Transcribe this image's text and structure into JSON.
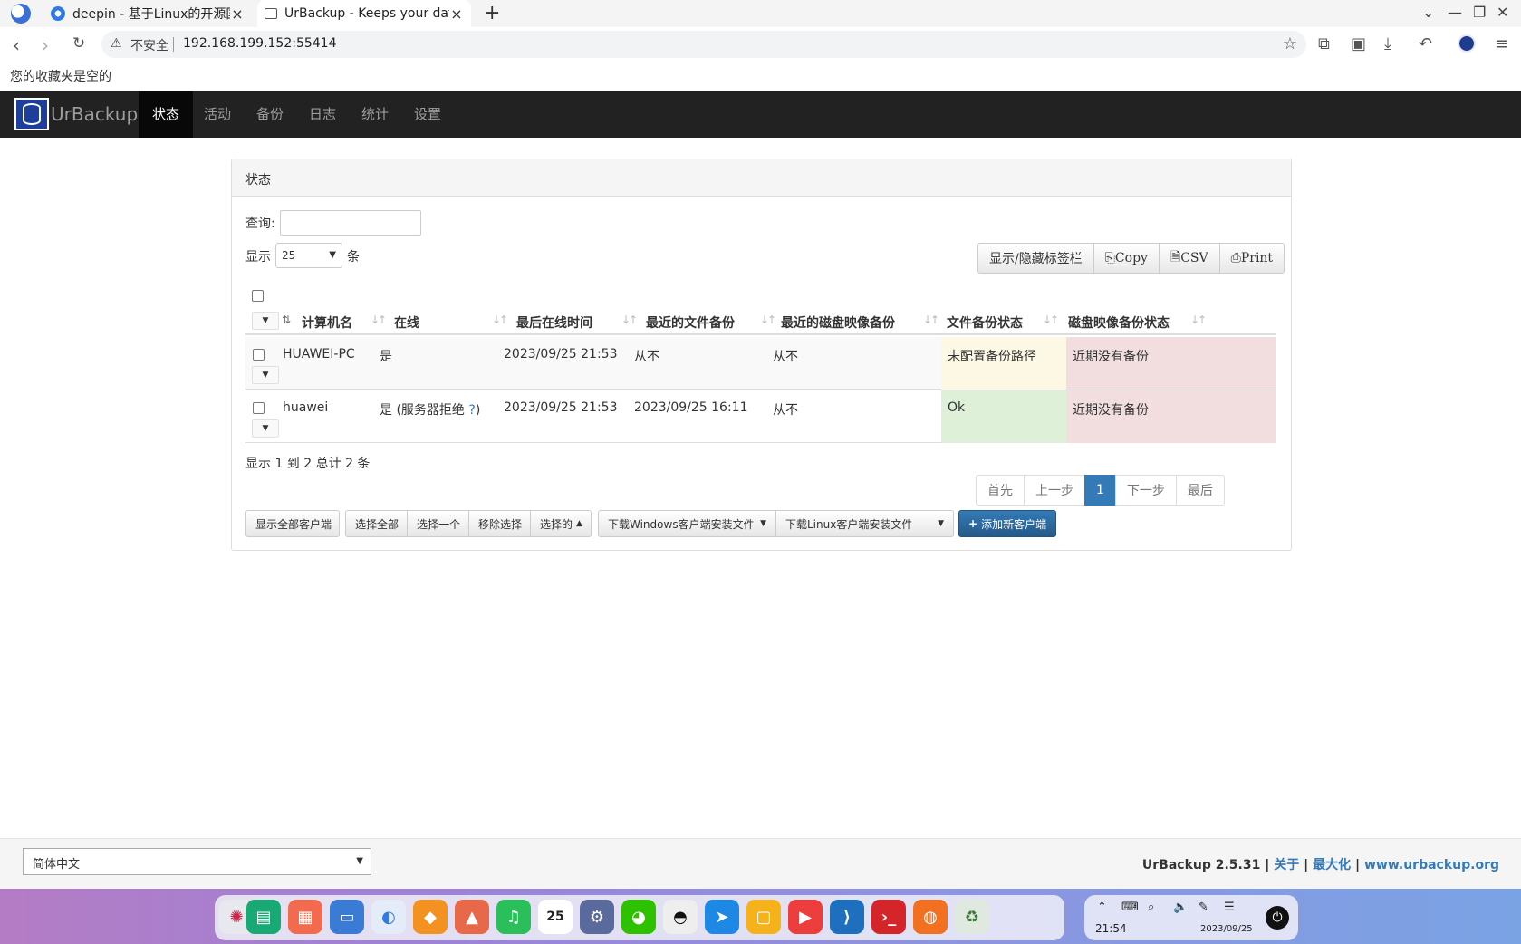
{
  "browser": {
    "tabs": [
      {
        "title": "deepin - 基于Linux的开源国"
      },
      {
        "title": "UrBackup - Keeps your dat"
      }
    ],
    "new_tab": "+",
    "insecure_label": "不安全",
    "url": "192.168.199.152:55414",
    "bookmarks_empty": "您的收藏夹是空的"
  },
  "navbar": {
    "brand": "UrBackup",
    "items": [
      {
        "label": "状态",
        "active": true
      },
      {
        "label": "活动"
      },
      {
        "label": "备份"
      },
      {
        "label": "日志"
      },
      {
        "label": "统计"
      },
      {
        "label": "设置"
      }
    ]
  },
  "panel": {
    "heading": "状态",
    "search_label": "查询:",
    "length_label": "显示",
    "length_value": "25",
    "length_unit": "条",
    "buttons": {
      "toggle_columns": "显示/隐藏标签栏",
      "copy": "Copy",
      "csv": "CSV",
      "print": "Print"
    },
    "columns": [
      "计算机名",
      "在线",
      "最后在线时间",
      "最近的文件备份",
      "最近的磁盘映像备份",
      "文件备份状态",
      "磁盘映像备份状态"
    ],
    "rows": [
      {
        "name": "HUAWEI-PC",
        "online": "是",
        "online_extra": "",
        "online_q": "",
        "online_close": "",
        "last_seen": "2023/09/25 21:53",
        "last_file_backup": "从不",
        "last_image_backup": "从不",
        "file_status": "未配置备份路径",
        "image_status": "近期没有备份"
      },
      {
        "name": "huawei",
        "online": "是",
        "online_extra": "(服务器拒绝 ",
        "online_q": "?",
        "online_close": ")",
        "last_seen": "2023/09/25 21:53",
        "last_file_backup": "2023/09/25 16:11",
        "last_image_backup": "从不",
        "file_status": "Ok",
        "image_status": "近期没有备份"
      }
    ],
    "info": "显示 1 到 2 总计 2 条",
    "pagination": {
      "first": "首先",
      "prev": "上一步",
      "current": "1",
      "next": "下一步",
      "last": "最后"
    },
    "bottom_buttons": {
      "show_all": "显示全部客户端",
      "select_all": "选择全部",
      "select_one": "选择一个",
      "remove_selection": "移除选择",
      "selected": "选择的",
      "download_windows": "下载Windows客户端安装文件",
      "download_linux": "下载Linux客户端安装文件",
      "add_client": "添加新客户端"
    }
  },
  "footer": {
    "language": "简体中文",
    "version": "UrBackup 2.5.31",
    "about": "关于",
    "maximize": "最大化",
    "website": "www.urbackup.org"
  },
  "taskbar": {
    "calendar_day": "25",
    "time": "21:54",
    "date": "2023/09/25"
  },
  "colors": {
    "navbar_bg": "#222222",
    "primary": "#337ab7",
    "warning_cell": "#fcf8e3",
    "danger_cell": "#f2dede",
    "success_cell": "#dff0d8"
  }
}
